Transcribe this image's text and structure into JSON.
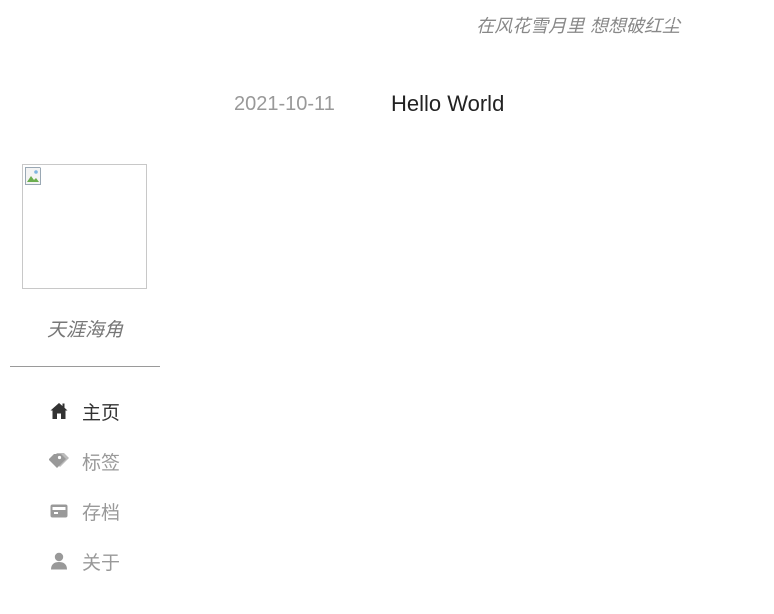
{
  "header": {
    "motto": "在风花雪月里 想想破红尘"
  },
  "posts": [
    {
      "date": "2021-10-11",
      "title": "Hello World"
    }
  ],
  "sidebar": {
    "site_name": "天涯海角",
    "nav": [
      {
        "label": "主页",
        "icon": "home-icon",
        "active": true
      },
      {
        "label": "标签",
        "icon": "tags-icon",
        "active": false
      },
      {
        "label": "存档",
        "icon": "archive-icon",
        "active": false
      },
      {
        "label": "关于",
        "icon": "user-icon",
        "active": false
      }
    ]
  },
  "colors": {
    "active_text": "#333333",
    "muted_text": "#999999",
    "icon_active": "#333333",
    "icon_muted": "#999999"
  }
}
